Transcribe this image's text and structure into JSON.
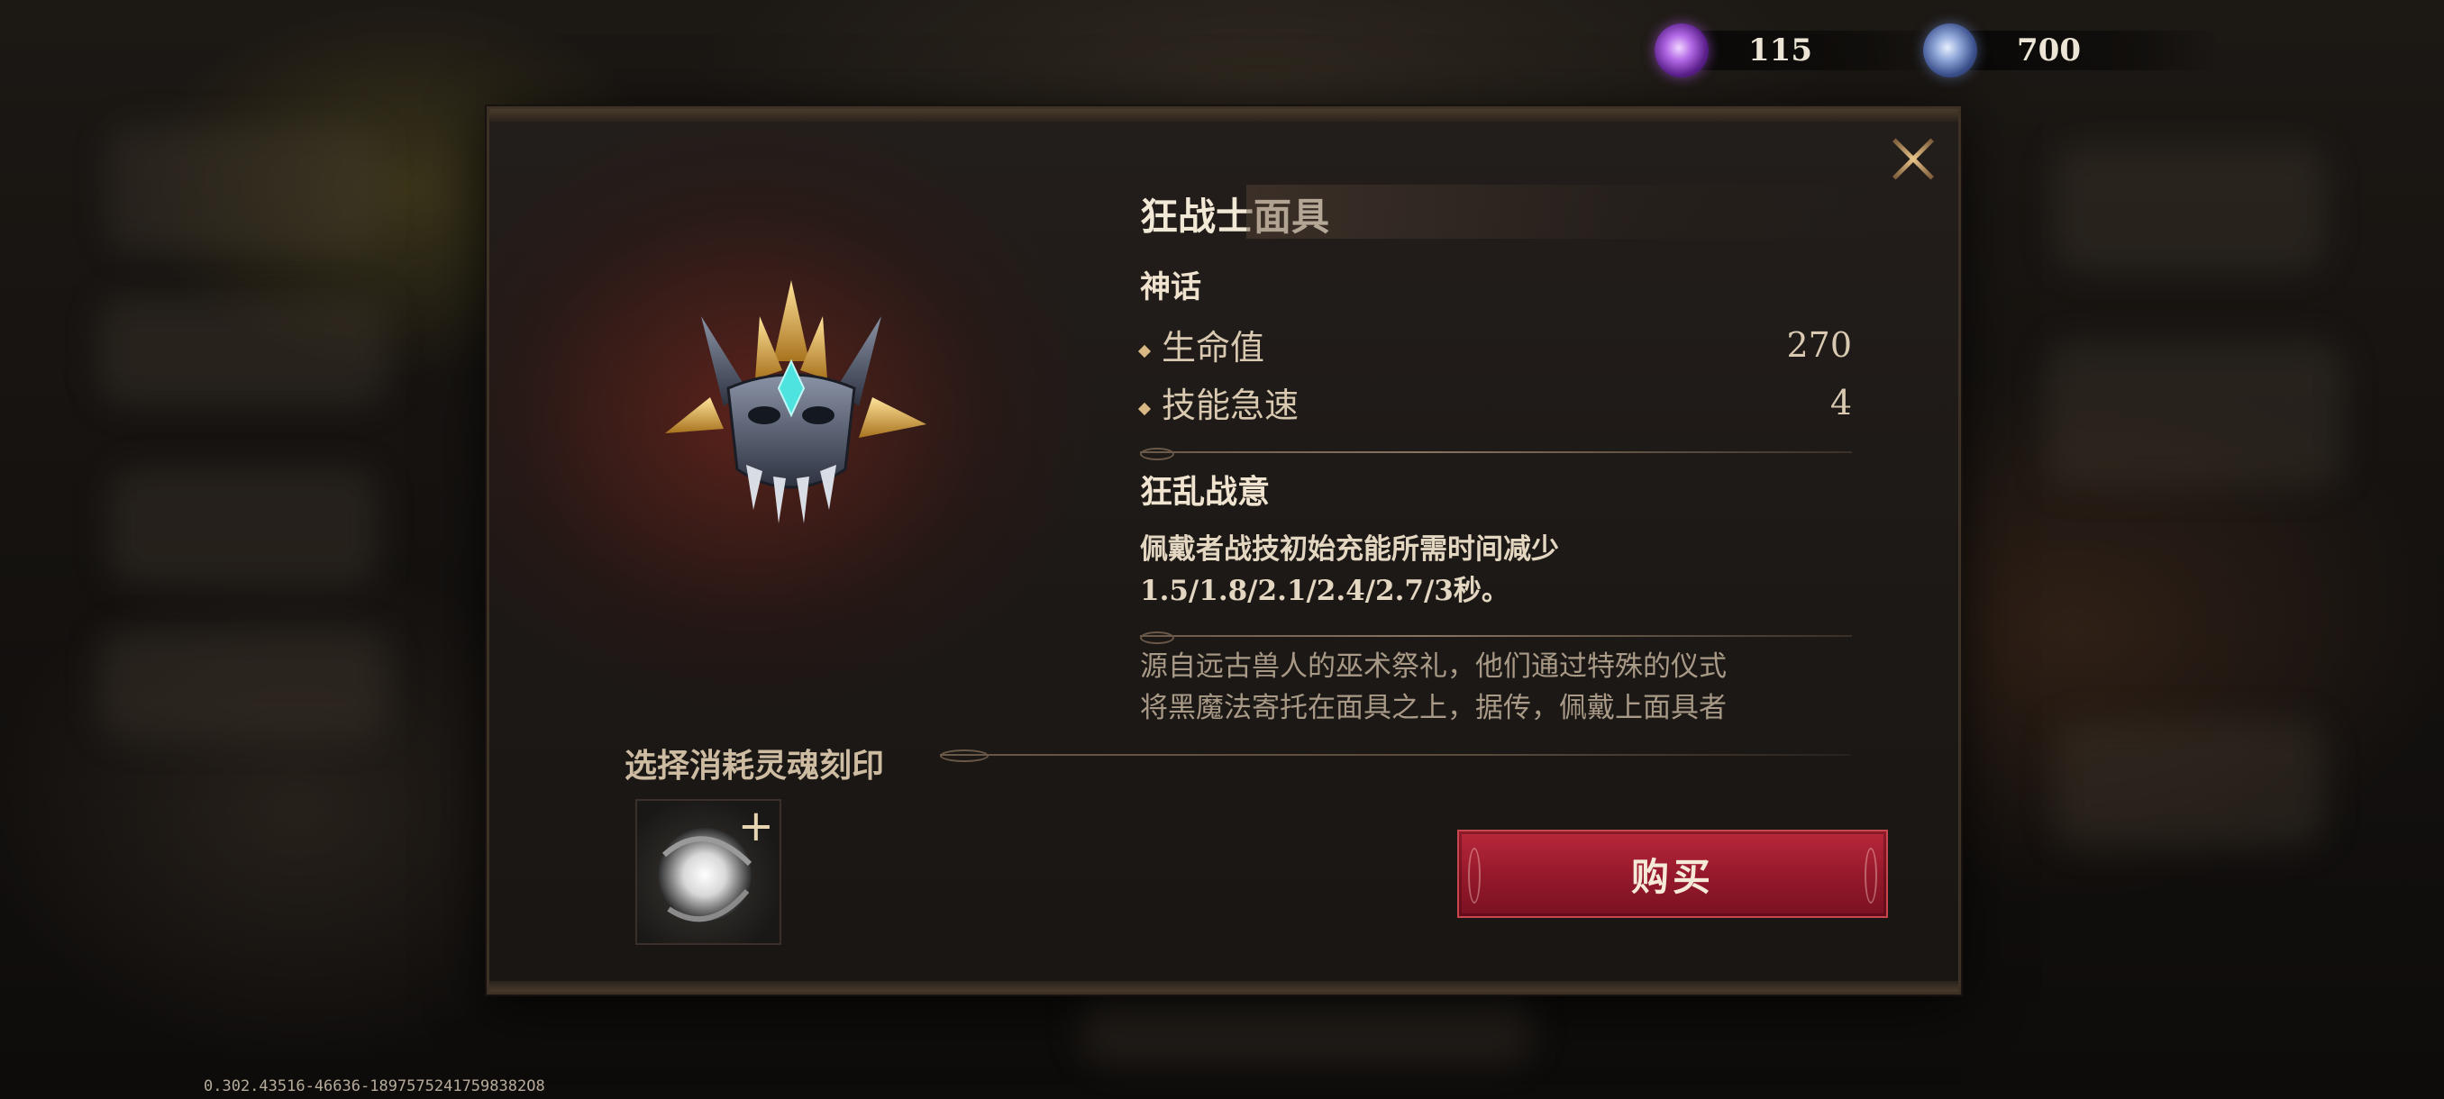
{
  "currency": {
    "purple": {
      "icon": "purple-soul-orb-icon",
      "value": "115"
    },
    "blue": {
      "icon": "blue-soul-orb-icon",
      "value": "700"
    }
  },
  "item": {
    "name": "狂战士面具",
    "rarity": "神话",
    "stats": [
      {
        "label": "生命值",
        "value": "270"
      },
      {
        "label": "技能急速",
        "value": "4"
      }
    ],
    "skill": {
      "name": "狂乱战意",
      "desc_line1": "佩戴者战技初始充能所需时间减少",
      "desc_line2": "1.5/1.8/2.1/2.4/2.7/3秒。"
    },
    "lore_line1": "源自远古兽人的巫术祭礼，他们通过特殊的仪式",
    "lore_line2": "将黑魔法寄托在面具之上，据传，佩戴上面具者"
  },
  "soul_select": {
    "label": "选择消耗灵魂刻印",
    "plus": "+"
  },
  "buy_label": "购买",
  "version": "0.302.43516-46636-18975752417598382O8"
}
